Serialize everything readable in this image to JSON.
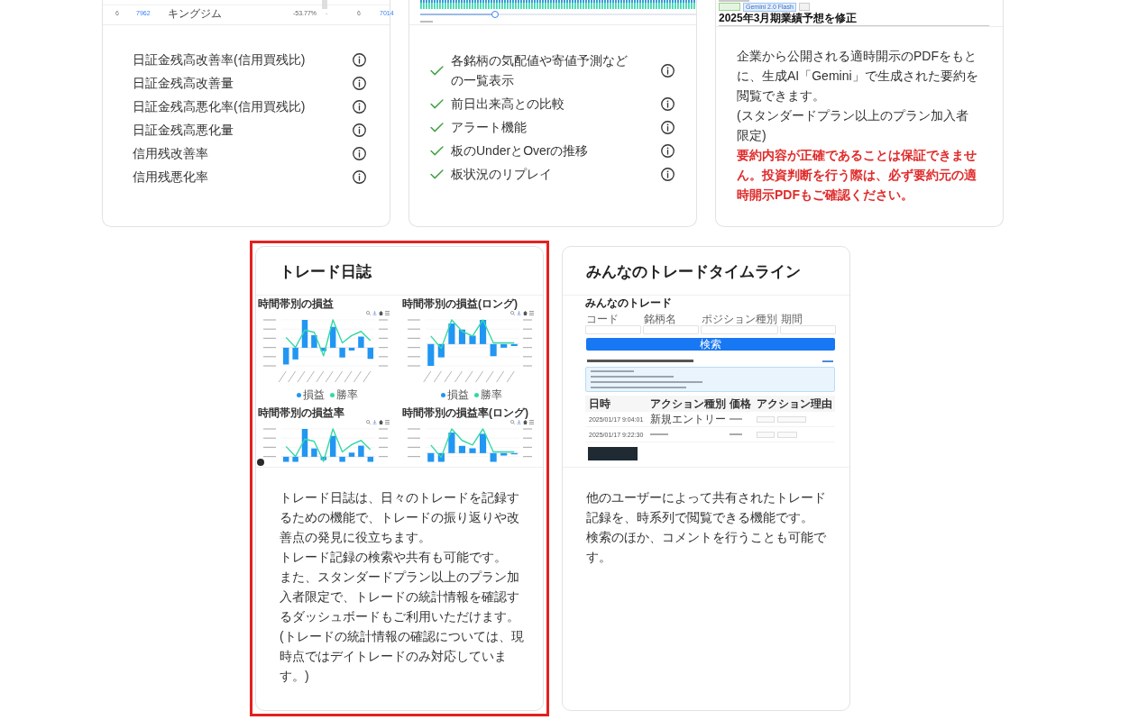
{
  "top_cards": [
    {
      "kind": "indicator_list",
      "screenshot": {
        "kind": "ranking_table",
        "row": {
          "column_1": "6",
          "column_2": "7962",
          "column_3": "キングジム",
          "column_4": "-53.77%",
          "column_5": "-",
          "column_6": "6",
          "column_7": "7014"
        }
      },
      "items": [
        {
          "label": "日証金残高改善率(信用買残比)"
        },
        {
          "label": "日証金残高改善量"
        },
        {
          "label": "日証金残高悪化率(信用買残比)"
        },
        {
          "label": "日証金残高悪化量"
        },
        {
          "label": "信用残改善率"
        },
        {
          "label": "信用残悪化率"
        }
      ]
    },
    {
      "kind": "check_list",
      "screenshot": {
        "kind": "board_replay",
        "slider": {
          "level": 0.27
        }
      },
      "items": [
        {
          "label": "各銘柄の気配値や寄値予測などの一覧表示"
        },
        {
          "label": "前日出来高との比較"
        },
        {
          "label": "アラート機能"
        },
        {
          "label": "板のUnderとOverの推移"
        },
        {
          "label": "板状況のリプレイ"
        }
      ]
    },
    {
      "kind": "description",
      "screenshot": {
        "kind": "disclosure_summary",
        "tag": "Gemini 2.0 Flash",
        "headline": "2025年3月期業績予想を修正"
      },
      "paragraphs": [
        {
          "text": "企業から公開される適時開示のPDFをもとに、生成AI「Gemini」で生成された要約を閲覧できます。",
          "warning": false
        },
        {
          "text": "(スタンダードプラン以上のプラン加入者限定)",
          "warning": false
        },
        {
          "text": "要約内容が正確であることは保証できません。投資判断を行う際は、必ず要約元の適時開示PDFもご確認ください。",
          "warning": true
        }
      ]
    }
  ],
  "bottom_cards": [
    {
      "title": "トレード日誌",
      "highlighted": true,
      "screenshot": {
        "kind": "trade_journal",
        "charts": [
          {
            "title": "時間帯別の損益",
            "legend": [
              {
                "label": "損益",
                "color": "#2196f3"
              },
              {
                "label": "勝率",
                "color": "#33d9a6"
              }
            ]
          },
          {
            "title": "時間帯別の損益(ロング)",
            "legend": [
              {
                "label": "損益",
                "color": "#2196f3"
              },
              {
                "label": "勝率",
                "color": "#33d9a6"
              }
            ]
          },
          {
            "title": "時間帯別の損益率"
          },
          {
            "title": "時間帯別の損益率(ロング)"
          }
        ]
      },
      "paragraphs": [
        "トレード日誌は、日々のトレードを記録するための機能で、トレードの振り返りや改善点の発見に役立ちます。",
        "トレード記録の検索や共有も可能です。",
        "また、スタンダードプラン以上のプラン加入者限定で、トレードの統計情報を確認するダッシュボードもご利用いただけます。",
        "(トレードの統計情報の確認については、現時点ではデイトレードのみ対応しています。)"
      ]
    },
    {
      "title": "みんなのトレードタイムライン",
      "highlighted": false,
      "screenshot": {
        "kind": "trade_timeline",
        "title": "みんなのトレード",
        "filters": [
          {
            "label": "コード"
          },
          {
            "label": "銘柄名"
          },
          {
            "label": "ポジション種別"
          },
          {
            "label": "期間"
          }
        ],
        "button": "検索",
        "columns": [
          "日時",
          "アクション種別",
          "価格",
          "アクション理由"
        ],
        "rows": [
          {
            "time": "2025/01/17 9:04:01",
            "action": "新規エントリー"
          },
          {
            "time": "2025/01/17 9:22:30"
          }
        ]
      },
      "paragraphs": [
        "他のユーザーによって共有されたトレード記録を、時系列で閲覧できる機能です。",
        "検索のほか、コメントを行うことも可能です。"
      ]
    }
  ]
}
